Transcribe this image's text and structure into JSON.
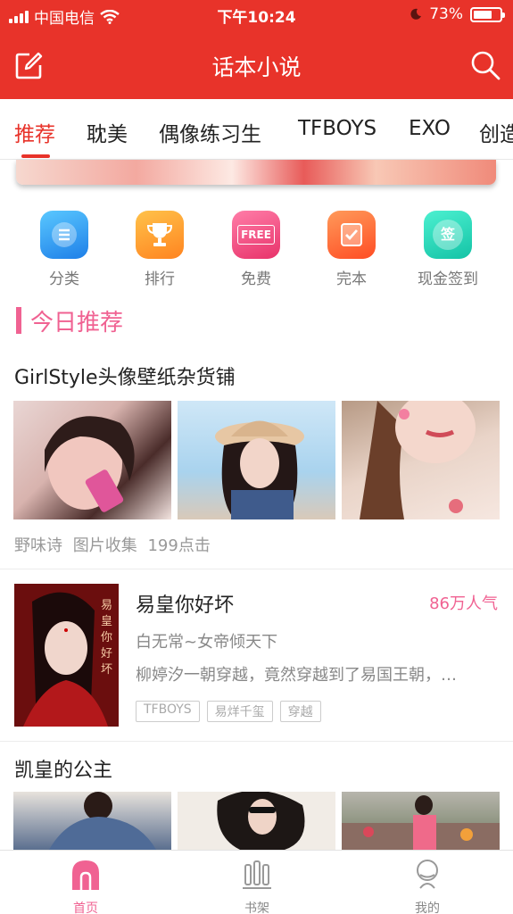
{
  "status": {
    "carrier": "中国电信",
    "time": "下午10:24",
    "battery": "73%",
    "battery_level": 0.73
  },
  "nav": {
    "title": "话本小说",
    "edit_icon": "edit-icon",
    "search_icon": "search-icon"
  },
  "tabs": [
    {
      "label": "推荐",
      "active": true
    },
    {
      "label": "耽美"
    },
    {
      "label": "偶像练习生"
    },
    {
      "label": "TFBOYS"
    },
    {
      "label": "EXO"
    },
    {
      "label": "创造"
    }
  ],
  "quick": [
    {
      "label": "分类",
      "icon": "list-icon",
      "color": "#3aa0f5"
    },
    {
      "label": "排行",
      "icon": "trophy-icon",
      "color": "#ff9a2e"
    },
    {
      "label": "免费",
      "icon": "free-icon",
      "color": "#f04e7e",
      "icon_text": "FREE"
    },
    {
      "label": "完本",
      "icon": "check-icon",
      "color": "#ff6a3a"
    },
    {
      "label": "现金签到",
      "icon": "sign-icon",
      "color": "#22d3b4",
      "icon_text": "签"
    }
  ],
  "section": {
    "title": "今日推荐"
  },
  "album": {
    "title": "GirlStyle头像壁纸杂货铺",
    "meta_author": "野味诗",
    "meta_category": "图片收集",
    "meta_clicks": "199点击"
  },
  "book": {
    "title": "易皇你好坏",
    "popularity": "86万人气",
    "author": "白无常~女帝倾天下",
    "description": "柳婷汐一朝穿越，竟然穿越到了易国王朝，…",
    "cover_text": "易皇你好坏",
    "tags": [
      "TFBOYS",
      "易烊千玺",
      "穿越"
    ]
  },
  "album2": {
    "title": "凯皇的公主"
  },
  "bottom": [
    {
      "label": "首页",
      "icon": "home-icon",
      "active": true
    },
    {
      "label": "书架",
      "icon": "bookshelf-icon"
    },
    {
      "label": "我的",
      "icon": "profile-icon"
    }
  ],
  "colors": {
    "brand_red": "#e8332a",
    "accent_pink": "#f06292"
  }
}
